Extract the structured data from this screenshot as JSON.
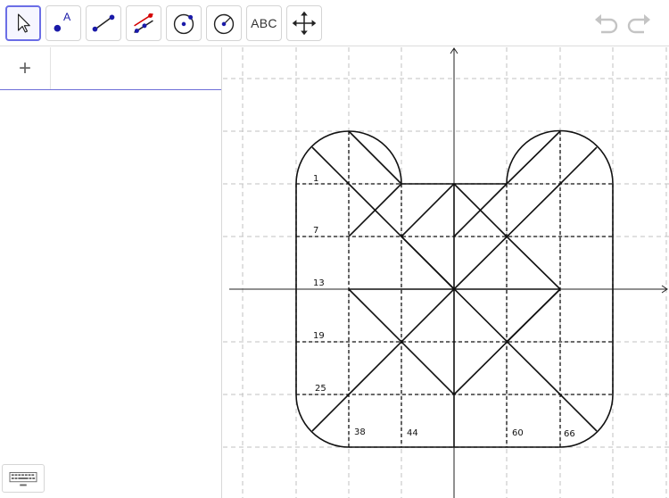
{
  "toolbar": {
    "tools": [
      {
        "name": "move-tool",
        "active": true
      },
      {
        "name": "point-tool",
        "icon_letter": "A"
      },
      {
        "name": "segment-tool"
      },
      {
        "name": "perpendicular-line-tool"
      },
      {
        "name": "circle-center-point-tool"
      },
      {
        "name": "circle-center-radius-tool"
      },
      {
        "name": "text-tool",
        "label": "ABC"
      },
      {
        "name": "move-graphics-view-tool"
      }
    ],
    "undo_icon": "undo-icon",
    "redo_icon": "redo-icon"
  },
  "algebra": {
    "add_label": "+"
  },
  "graphics": {
    "grid": true,
    "labels": {
      "l1": "1",
      "l7": "7",
      "l13": "13",
      "l19": "19",
      "l25": "25",
      "l38": "38",
      "l44": "44",
      "l60": "60",
      "l66": "66"
    }
  },
  "colors": {
    "active_tool_border": "#6b6ee6",
    "point_blue": "#1a1aa8",
    "accent_red": "#d40000",
    "grid": "#bdbdbd"
  }
}
